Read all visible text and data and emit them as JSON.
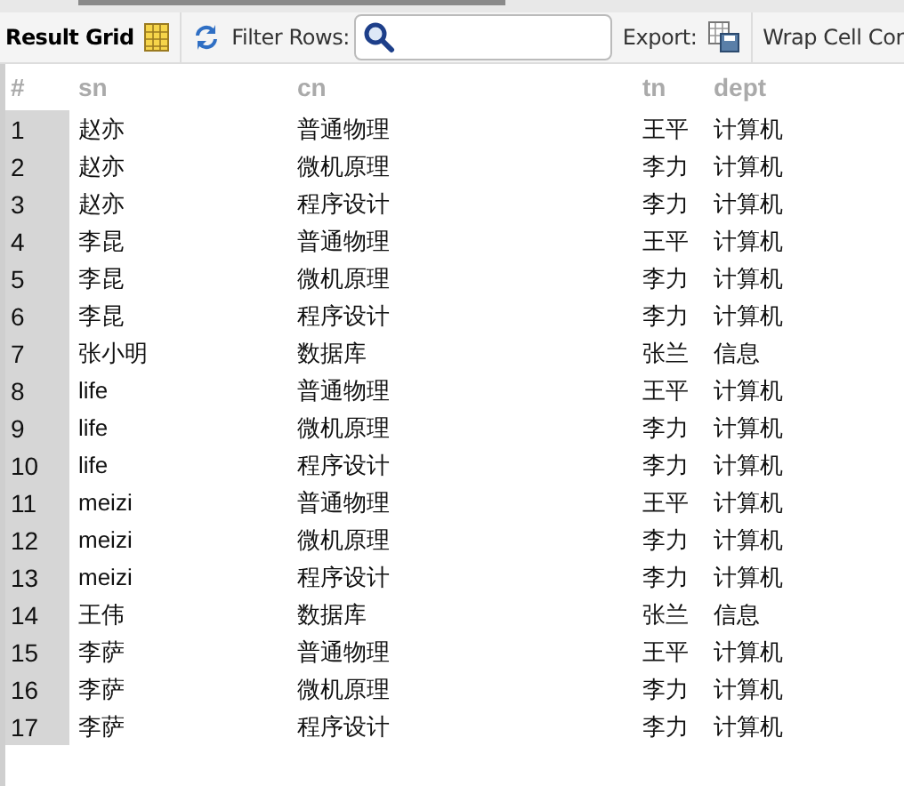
{
  "toolbar": {
    "title": "Result Grid",
    "filter_label": "Filter Rows:",
    "export_label": "Export:",
    "wrap_label": "Wrap Cell Cor"
  },
  "table": {
    "columns": [
      "#",
      "sn",
      "cn",
      "tn",
      "dept"
    ],
    "rows": [
      [
        "1",
        "赵亦",
        "普通物理",
        "王平",
        "计算机"
      ],
      [
        "2",
        "赵亦",
        "微机原理",
        "李力",
        "计算机"
      ],
      [
        "3",
        "赵亦",
        "程序设计",
        "李力",
        "计算机"
      ],
      [
        "4",
        "李昆",
        "普通物理",
        "王平",
        "计算机"
      ],
      [
        "5",
        "李昆",
        "微机原理",
        "李力",
        "计算机"
      ],
      [
        "6",
        "李昆",
        "程序设计",
        "李力",
        "计算机"
      ],
      [
        "7",
        "张小明",
        "数据库",
        "张兰",
        "信息"
      ],
      [
        "8",
        "life",
        "普通物理",
        "王平",
        "计算机"
      ],
      [
        "9",
        "life",
        "微机原理",
        "李力",
        "计算机"
      ],
      [
        "10",
        "life",
        "程序设计",
        "李力",
        "计算机"
      ],
      [
        "11",
        "meizi",
        "普通物理",
        "王平",
        "计算机"
      ],
      [
        "12",
        "meizi",
        "微机原理",
        "李力",
        "计算机"
      ],
      [
        "13",
        "meizi",
        "程序设计",
        "李力",
        "计算机"
      ],
      [
        "14",
        "王伟",
        "数据库",
        "张兰",
        "信息"
      ],
      [
        "15",
        "李萨",
        "普通物理",
        "王平",
        "计算机"
      ],
      [
        "16",
        "李萨",
        "微机原理",
        "李力",
        "计算机"
      ],
      [
        "17",
        "李萨",
        "程序设计",
        "李力",
        "计算机"
      ]
    ]
  }
}
